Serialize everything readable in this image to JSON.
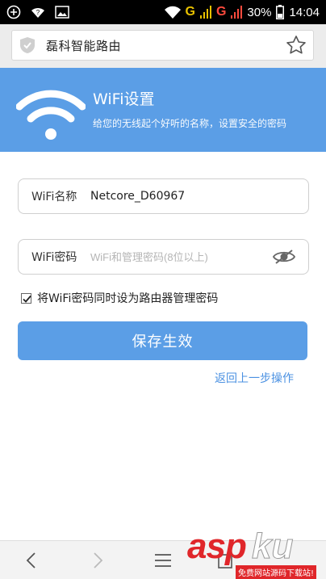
{
  "status_bar": {
    "network_g1": "G",
    "network_g2": "G",
    "battery": "30%",
    "time": "14:04"
  },
  "browser": {
    "page_title": "磊科智能路由"
  },
  "banner": {
    "title": "WiFi设置",
    "subtitle": "给您的无线起个好听的名称，设置安全的密码"
  },
  "form": {
    "wifi_name_label": "WiFi名称",
    "wifi_name_value": "Netcore_D60967",
    "wifi_password_label": "WiFi密码",
    "wifi_password_placeholder": "WiFi和管理密码(8位以上)",
    "sync_checkbox_label": "将WiFi密码同时设为路由器管理密码",
    "sync_checked": true,
    "save_button": "保存生效",
    "back_link": "返回上一步操作"
  },
  "watermark": {
    "brand_a": "asp",
    "brand_b": "ku",
    "tagline": "免费网站源码下载站!"
  },
  "colors": {
    "primary": "#5b9ee6",
    "link": "#4b91e2"
  }
}
